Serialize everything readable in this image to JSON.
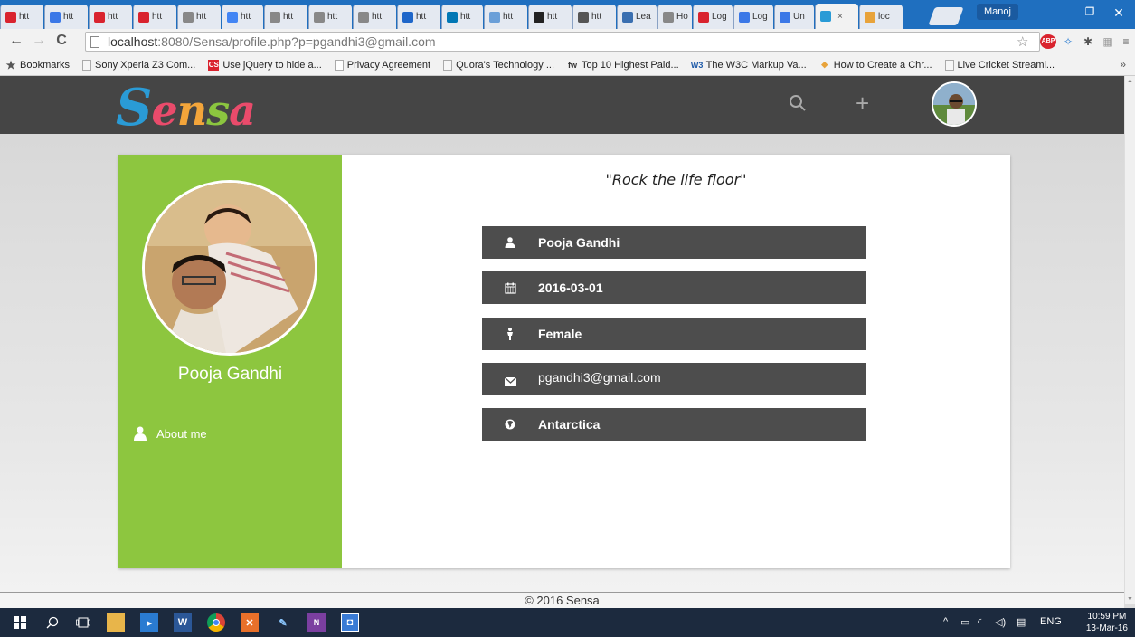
{
  "browser": {
    "tabs": [
      {
        "label": "htt",
        "color": "#d9232e"
      },
      {
        "label": "htt",
        "color": "#3b78e7"
      },
      {
        "label": "htt",
        "color": "#d9232e"
      },
      {
        "label": "htt",
        "color": "#d9232e"
      },
      {
        "label": "htt",
        "color": "#888888"
      },
      {
        "label": "htt",
        "color": "#4285f4"
      },
      {
        "label": "htt",
        "color": "#888888"
      },
      {
        "label": "htt",
        "color": "#888888"
      },
      {
        "label": "htt",
        "color": "#888888"
      },
      {
        "label": "htt",
        "color": "#1e66c9"
      },
      {
        "label": "htt",
        "color": "#0077b5"
      },
      {
        "label": "htt",
        "color": "#6a9fd8"
      },
      {
        "label": "htt",
        "color": "#222222"
      },
      {
        "label": "htt",
        "color": "#555555"
      },
      {
        "label": "Lea",
        "color": "#3a6fb0"
      },
      {
        "label": "Ho",
        "color": "#888888"
      },
      {
        "label": "Log",
        "color": "#d9232e"
      },
      {
        "label": "Log",
        "color": "#3b78e7"
      },
      {
        "label": "Un",
        "color": "#3b78e7"
      },
      {
        "label": "",
        "color": "#2a9bd6"
      },
      {
        "label": "loc",
        "color": "#e8a33a"
      }
    ],
    "profile_name": "Manoj",
    "url_host": "localhost",
    "url_path": ":8080/Sensa/profile.php?p=pgandhi3@gmail.com",
    "bookmarks": [
      {
        "label": "Bookmarks",
        "color": "#555555",
        "glyph": "★"
      },
      {
        "label": "Sony Xperia Z3 Com...",
        "color": "#333333",
        "glyph": ""
      },
      {
        "label": "Use jQuery to hide a...",
        "color": "#d9232e",
        "glyph": "CS"
      },
      {
        "label": "Privacy Agreement",
        "color": "#ffffff",
        "glyph": ""
      },
      {
        "label": "Quora's Technology ...",
        "color": "#888888",
        "glyph": ""
      },
      {
        "label": "Top 10 Highest Paid...",
        "color": "#333333",
        "glyph": "fw"
      },
      {
        "label": "The W3C Markup Va...",
        "color": "#1e5aa8",
        "glyph": "W3"
      },
      {
        "label": "How to Create a Chr...",
        "color": "#e8a33a",
        "glyph": "◆"
      },
      {
        "label": "Live Cricket Streami...",
        "color": "#888888",
        "glyph": ""
      }
    ],
    "bookmarks_more": "»"
  },
  "site": {
    "logo_letters": [
      "S",
      "e",
      "n",
      "s",
      "a"
    ],
    "search_icon": "search-icon",
    "add_icon": "+",
    "quote": "\"Rock the life floor\"",
    "profile_name": "Pooja Gandhi",
    "about_label": "About me",
    "info": [
      {
        "icon": "user-icon",
        "text": "Pooja Gandhi"
      },
      {
        "icon": "calendar-icon",
        "text": "2016-03-01"
      },
      {
        "icon": "female-icon",
        "text": "Female"
      },
      {
        "icon": "envelope-icon",
        "text": "pgandhi3@gmail.com"
      },
      {
        "icon": "globe-icon",
        "text": "Antarctica"
      }
    ],
    "footer": "© 2016 Sensa"
  },
  "taskbar": {
    "lang": "ENG",
    "time": "10:59 PM",
    "date": "13-Mar-16"
  },
  "colors": {
    "sidebar": "#8dc63f",
    "header": "#454545",
    "info_row": "#4d4d4d"
  }
}
